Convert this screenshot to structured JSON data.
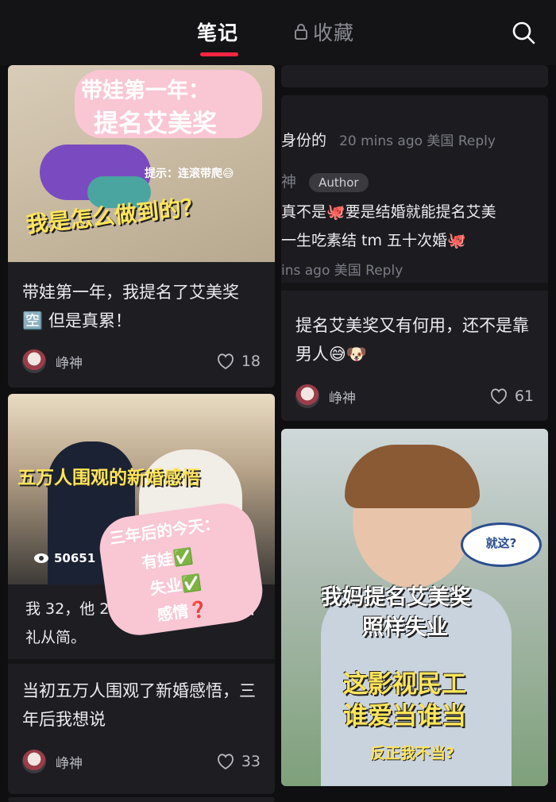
{
  "header": {
    "tab_notes": "笔记",
    "tab_favorites": "收藏",
    "accent": "#ff2442"
  },
  "icons": {
    "search": "search-icon",
    "lock": "lock-icon",
    "heart": "heart-icon",
    "view": "eye-icon"
  },
  "cards": {
    "c1": {
      "image_text": {
        "top_line1": "带娃第一年：",
        "top_line2": "提名艾美奖",
        "hint": "提示：连滚带爬😅",
        "bottom": "我是怎么做到的？"
      },
      "title": "带娃第一年，我提名了艾美奖 🈳 但是真累！",
      "author": "峥神",
      "likes": "18"
    },
    "c2": {
      "image_text": {
        "banner": "五万人围观的新婚感悟",
        "views": "50651",
        "sticker_l1": "三年后的今天：",
        "sticker_l2": "有娃✅",
        "sticker_l3": "失业✅",
        "sticker_l4": "感情❓"
      },
      "caption_line1": "我 32，他 27。钻",
      "caption_line1_end": "婚",
      "caption_line2": "礼从简。",
      "title": "当初五万人围观了新婚感悟，三年后我想说",
      "author": "峥神",
      "likes": "33"
    },
    "c3": {
      "comment_line1": "身份的",
      "comment_line1_meta": "20 mins ago 美国 Reply",
      "comment_author_prefix": "神",
      "author_chip": "Author",
      "comment_line2": "真不是🐙要是结婚就能提名艾美",
      "comment_line3": "一生吃素结 tm 五十次婚🐙",
      "comment_line4_meta": "ins ago 美国 Reply",
      "title": "提名艾美奖又有何用，还不是靠男人😅🐶",
      "author": "峥神",
      "likes": "61"
    },
    "c4": {
      "image_text": {
        "bubble": "就这?",
        "line1": "我妈提名艾美奖",
        "line2": "照样失业",
        "line3": "这影视民工",
        "line4": "谁爱当谁当",
        "line5": "反正我不当?"
      }
    }
  }
}
